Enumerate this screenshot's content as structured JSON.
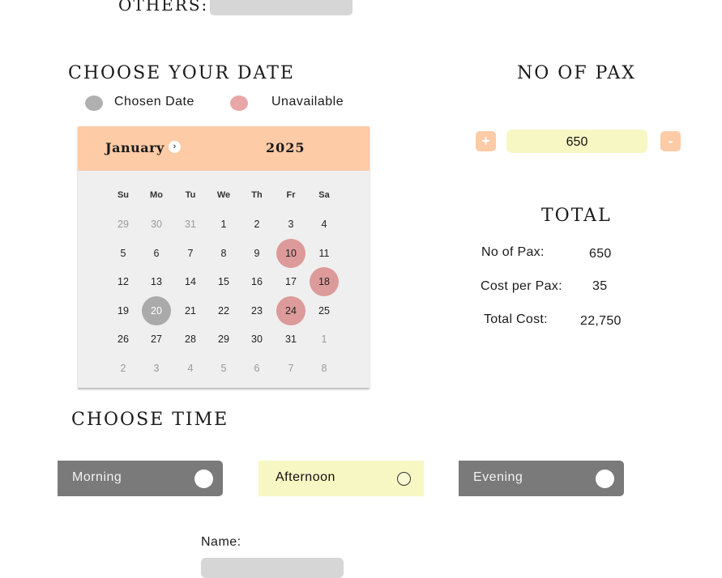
{
  "others": {
    "label": "OTHERS:",
    "value": ""
  },
  "date_section": {
    "heading": "CHOOSE YOUR DATE",
    "legend": {
      "chosen": "Chosen Date",
      "unavailable": "Unavailable"
    }
  },
  "calendar": {
    "month": "January",
    "year": "2025",
    "next_icon": "chevron-right-icon",
    "weekdays": [
      "Su",
      "Mo",
      "Tu",
      "We",
      "Th",
      "Fr",
      "Sa"
    ],
    "days": [
      {
        "d": "29",
        "state": "muted"
      },
      {
        "d": "30",
        "state": "muted"
      },
      {
        "d": "31",
        "state": "muted"
      },
      {
        "d": "1",
        "state": "normal"
      },
      {
        "d": "2",
        "state": "normal"
      },
      {
        "d": "3",
        "state": "normal"
      },
      {
        "d": "4",
        "state": "normal"
      },
      {
        "d": "5",
        "state": "normal"
      },
      {
        "d": "6",
        "state": "normal"
      },
      {
        "d": "7",
        "state": "normal"
      },
      {
        "d": "8",
        "state": "normal"
      },
      {
        "d": "9",
        "state": "normal"
      },
      {
        "d": "10",
        "state": "unavailable"
      },
      {
        "d": "11",
        "state": "normal"
      },
      {
        "d": "12",
        "state": "normal"
      },
      {
        "d": "13",
        "state": "normal"
      },
      {
        "d": "14",
        "state": "normal"
      },
      {
        "d": "15",
        "state": "normal"
      },
      {
        "d": "16",
        "state": "normal"
      },
      {
        "d": "17",
        "state": "normal"
      },
      {
        "d": "18",
        "state": "unavailable"
      },
      {
        "d": "19",
        "state": "normal"
      },
      {
        "d": "20",
        "state": "chosen"
      },
      {
        "d": "21",
        "state": "normal"
      },
      {
        "d": "22",
        "state": "normal"
      },
      {
        "d": "23",
        "state": "normal"
      },
      {
        "d": "24",
        "state": "unavailable"
      },
      {
        "d": "25",
        "state": "normal"
      },
      {
        "d": "26",
        "state": "normal"
      },
      {
        "d": "27",
        "state": "normal"
      },
      {
        "d": "28",
        "state": "normal"
      },
      {
        "d": "29",
        "state": "normal"
      },
      {
        "d": "30",
        "state": "normal"
      },
      {
        "d": "31",
        "state": "normal"
      },
      {
        "d": "1",
        "state": "muted"
      },
      {
        "d": "2",
        "state": "muted"
      },
      {
        "d": "3",
        "state": "muted"
      },
      {
        "d": "4",
        "state": "muted"
      },
      {
        "d": "5",
        "state": "muted"
      },
      {
        "d": "6",
        "state": "muted"
      },
      {
        "d": "7",
        "state": "muted"
      },
      {
        "d": "8",
        "state": "muted"
      }
    ]
  },
  "pax": {
    "heading": "NO OF PAX",
    "plus_label": "+",
    "minus_label": "-",
    "value": "650"
  },
  "total": {
    "heading": "TOTAL",
    "pax_label": "No of Pax:",
    "pax_value": "650",
    "cost_label": "Cost per Pax:",
    "cost_value": "35",
    "total_label": "Total Cost:",
    "total_value": "22,750"
  },
  "time_section": {
    "heading": "CHOOSE TIME",
    "options": [
      {
        "label": "Morning",
        "selected": false
      },
      {
        "label": "Afternoon",
        "selected": true
      },
      {
        "label": "Evening",
        "selected": false
      }
    ]
  },
  "name_field": {
    "label": "Name:",
    "value": ""
  },
  "colors": {
    "accent_peach": "#fdcba6",
    "highlight_yellow": "#f7f7c4",
    "unavailable": "#dd9a9a",
    "chosen": "#aaaaaa",
    "toggle_off": "#7a7a7a"
  }
}
